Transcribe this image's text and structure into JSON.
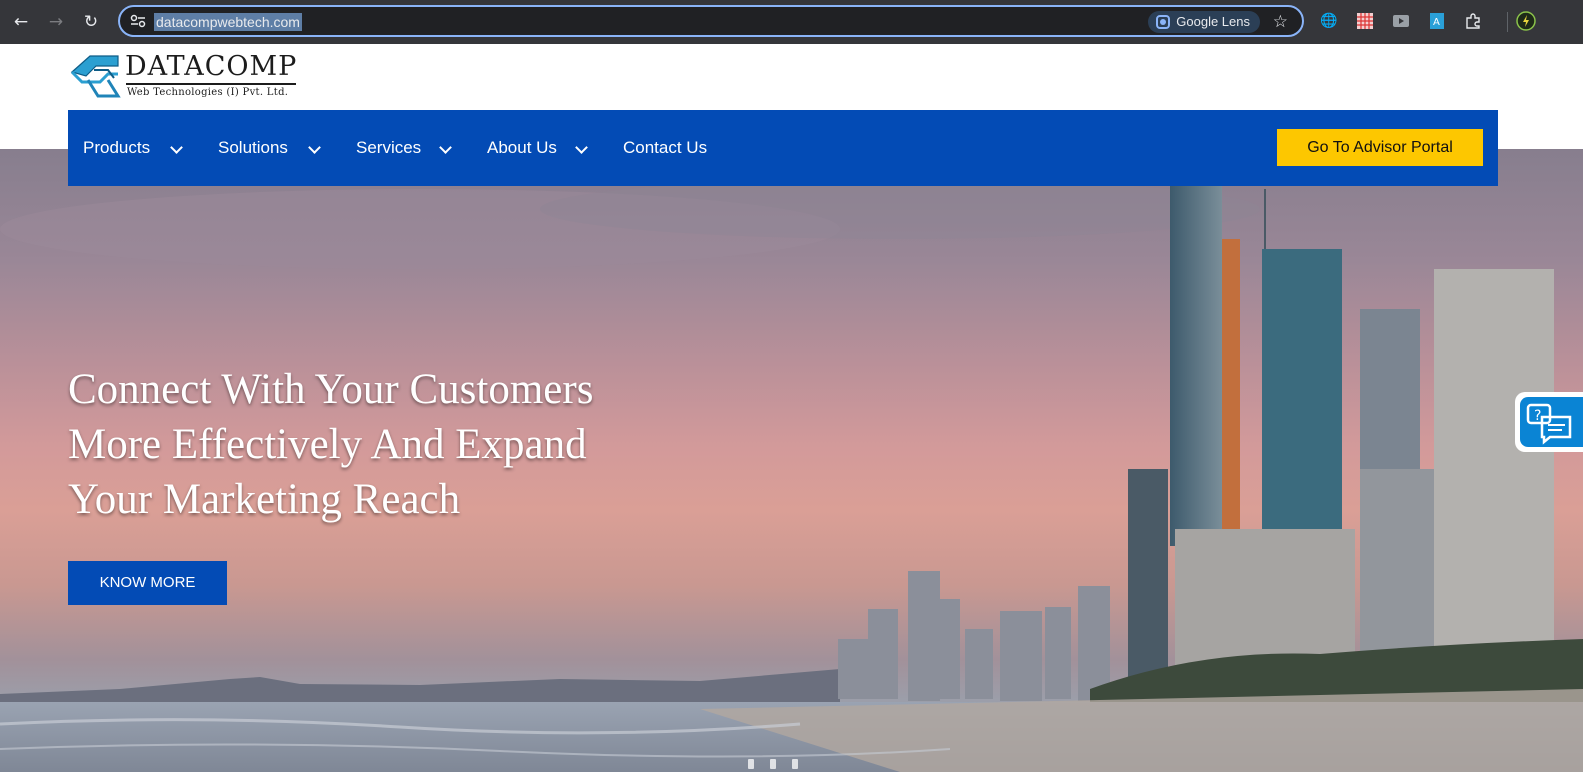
{
  "browser": {
    "url": "datacompwebtech.com",
    "lens_label": "Google Lens"
  },
  "header": {
    "logo_name": "DATACOMP",
    "logo_subtitle": "Web Technologies (I) Pvt. Ltd."
  },
  "nav": {
    "items": [
      {
        "label": "Products",
        "has_dropdown": true
      },
      {
        "label": "Solutions",
        "has_dropdown": true
      },
      {
        "label": "Services",
        "has_dropdown": true
      },
      {
        "label": "About Us",
        "has_dropdown": true
      },
      {
        "label": "Contact Us",
        "has_dropdown": false
      }
    ],
    "portal_button": "Go To Advisor Portal"
  },
  "hero": {
    "headline_lines": [
      "Connect With Your Customers",
      "More Effectively And Expand",
      "Your Marketing Reach"
    ],
    "cta_label": "KNOW MORE"
  },
  "colors": {
    "nav_blue": "#034bb5",
    "portal_yellow": "#fdc700",
    "chrome_dark": "#35363a"
  }
}
